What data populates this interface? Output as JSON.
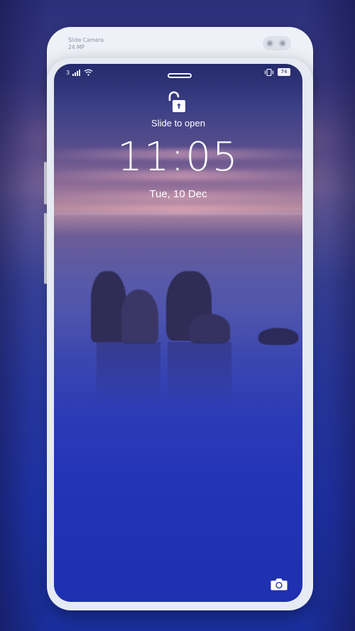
{
  "slider": {
    "title": "Slide Camera",
    "subtitle": "24 MP"
  },
  "status_bar": {
    "carrier_label": "3",
    "battery_level": "74",
    "icons": [
      "signal-icon",
      "wifi-icon",
      "vibrate-icon",
      "battery-icon"
    ]
  },
  "lockscreen": {
    "lock_icon": "unlock-icon",
    "prompt": "Slide to open",
    "time": "11:05",
    "date": "Tue, 10 Dec",
    "shortcut_icon": "camera-icon"
  },
  "colors": {
    "text": "#ffffff",
    "phone_frame": "#e6eaf2",
    "water": "#2233b8"
  }
}
